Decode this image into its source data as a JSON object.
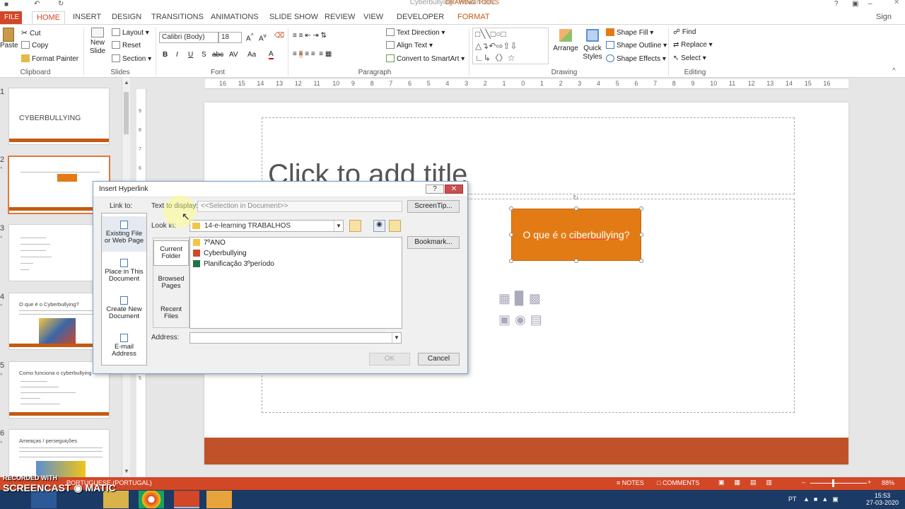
{
  "window": {
    "title": "Cyberbullying - PowerPoint",
    "context_tab_group": "DRAWING TOOLS"
  },
  "ribbon_tabs": [
    "FILE",
    "HOME",
    "INSERT",
    "DESIGN",
    "TRANSITIONS",
    "ANIMATIONS",
    "SLIDE SHOW",
    "REVIEW",
    "VIEW",
    "DEVELOPER",
    "FORMAT"
  ],
  "ribbon": {
    "clipboard": {
      "paste": "Paste",
      "cut": "Cut",
      "copy": "Copy",
      "format_painter": "Format Painter",
      "label": "Clipboard"
    },
    "slides": {
      "new_slide": "New",
      "new_slide2": "Slide",
      "layout": "Layout",
      "reset": "Reset",
      "section": "Section",
      "label": "Slides"
    },
    "font": {
      "name": "Calibri (Body)",
      "size": "18",
      "label": "Font"
    },
    "paragraph": {
      "text_direction": "Text Direction",
      "align_text": "Align Text",
      "convert_smartart": "Convert to SmartArt",
      "label": "Paragraph"
    },
    "drawing": {
      "arrange": "Arrange",
      "quick_styles": "Quick",
      "quick_styles2": "Styles",
      "shape_fill": "Shape Fill",
      "shape_outline": "Shape Outline",
      "shape_effects": "Shape Effects",
      "label": "Drawing"
    },
    "editing": {
      "find": "Find",
      "replace": "Replace",
      "select": "Select",
      "label": "Editing"
    }
  },
  "ruler_ticks": [
    "16",
    "15",
    "14",
    "13",
    "12",
    "11",
    "10",
    "9",
    "8",
    "7",
    "6",
    "5",
    "4",
    "3",
    "2",
    "1",
    "0",
    "1",
    "2",
    "3",
    "4",
    "5",
    "6",
    "7",
    "8",
    "9",
    "10",
    "11",
    "12",
    "13",
    "14",
    "15",
    "16"
  ],
  "thumbnails": [
    {
      "num": "1",
      "title": "CYBERBULLYING"
    },
    {
      "num": "2",
      "title": ""
    },
    {
      "num": "3",
      "title": ""
    },
    {
      "num": "4",
      "title": "O que é o Cyberbullying?"
    },
    {
      "num": "5",
      "title": "Como funciona o cyberbullying"
    },
    {
      "num": "6",
      "title": "Ameaças / perseguições"
    }
  ],
  "slide": {
    "title_placeholder": "Click to add title",
    "shape_text_a": "O que é o ",
    "shape_text_b": "ciberbullying",
    "shape_text_c": "?"
  },
  "dialog": {
    "title": "Insert Hyperlink",
    "link_to_label": "Link to:",
    "text_to_display_label": "Text to display:",
    "text_to_display_value": "<<Selection in Document>>",
    "screentip": "ScreenTip...",
    "look_in_label": "Look in:",
    "look_in_value": "14-e-learning TRABALHOS",
    "bookmark": "Bookmark...",
    "address_label": "Address:",
    "ok": "OK",
    "cancel": "Cancel",
    "link_options": [
      {
        "line1": "Existing File",
        "line2": "or Web Page"
      },
      {
        "line1": "Place in This",
        "line2": "Document"
      },
      {
        "line1": "Create New",
        "line2": "Document"
      },
      {
        "line1": "E-mail",
        "line2": "Address"
      }
    ],
    "sub_options": [
      {
        "line1": "Current",
        "line2": "Folder"
      },
      {
        "line1": "Browsed",
        "line2": "Pages"
      },
      {
        "line1": "Recent",
        "line2": "Files"
      }
    ],
    "files": [
      "7ºANO",
      "Cyberbullying",
      "Planificação 3ºperíodo"
    ]
  },
  "statusbar": {
    "language": "PORTUGUESE (PORTUGAL)",
    "notes": "NOTES",
    "comments": "COMMENTS",
    "zoom": "88%"
  },
  "taskbar": {
    "lang": "PT",
    "time": "15:53",
    "date": "27-03-2020"
  },
  "watermark": {
    "line1": "RECORDED WITH",
    "line2": "SCREENCAST",
    "line3": "MATIC"
  }
}
